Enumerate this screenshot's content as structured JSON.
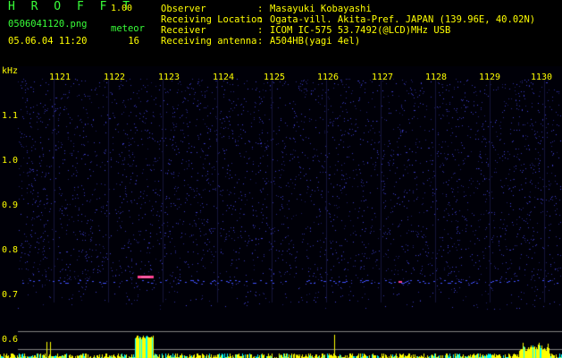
{
  "header": {
    "title": "H R O F F T",
    "version": "1.00",
    "filename": "0506041120.png",
    "datetime": "05.06.04 11:20",
    "meteor_label": "meteor",
    "meteor_count": "16",
    "info": [
      {
        "key": "Observer",
        "value": "Masayuki Kobayashi"
      },
      {
        "key": "Receiving Location",
        "value": "Ogata-vill. Akita-Pref. JAPAN (139.96E, 40.02N)"
      },
      {
        "key": "Receiver",
        "value": "ICOM IC-575 53.7492(@LCD)MHz USB"
      },
      {
        "key": "Receiving antenna",
        "value": "A504HB(yagi 4el)"
      }
    ],
    "separator": ":"
  },
  "spectrogram": {
    "unit_label": "kHz",
    "y_ticks": [
      "1.1",
      "1.0",
      "0.9",
      "0.8",
      "0.7",
      "0.6"
    ],
    "x_ticks": [
      "1121",
      "1122",
      "1123",
      "1124",
      "1125",
      "1126",
      "1127",
      "1128",
      "1129",
      "1130"
    ],
    "colors": {
      "background": "#000010",
      "noise": "#3030c0",
      "echo": "#ff4080",
      "grid": "#1a1a40",
      "level": "#ffff00",
      "level_alt": "#00ffff"
    }
  }
}
